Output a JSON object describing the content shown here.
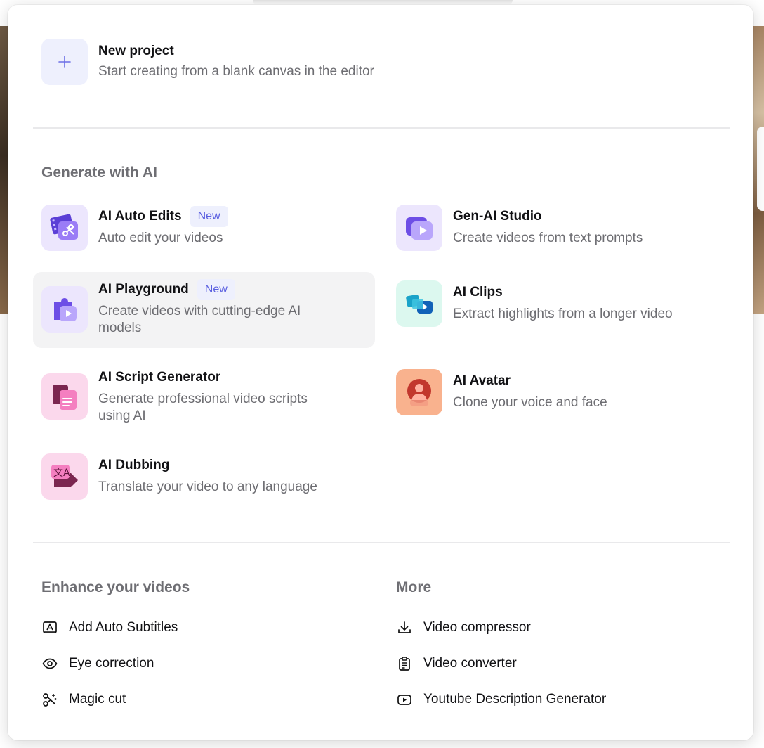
{
  "new_project": {
    "title": "New project",
    "subtitle": "Start creating from a blank canvas in the editor"
  },
  "generate": {
    "heading": "Generate with AI",
    "items": [
      {
        "title": "AI Auto Edits",
        "badge": "New",
        "subtitle": "Auto edit your videos",
        "icon": "film-scissors-icon"
      },
      {
        "title": "Gen-AI Studio",
        "subtitle": "Create videos from text prompts",
        "icon": "video-play-icon"
      },
      {
        "title": "AI Playground",
        "badge": "New",
        "subtitle": "Create videos with cutting-edge AI models",
        "icon": "puzzle-play-icon"
      },
      {
        "title": "AI Clips",
        "subtitle": "Extract highlights from a longer video",
        "icon": "clips-icon"
      },
      {
        "title": "AI Script Generator",
        "subtitle": "Generate professional video scripts using AI",
        "icon": "script-document-icon"
      },
      {
        "title": "AI Avatar",
        "subtitle": "Clone your voice and face",
        "icon": "avatar-person-icon"
      },
      {
        "title": "AI Dubbing",
        "subtitle": "Translate your video to any language",
        "icon": "translate-icon"
      }
    ]
  },
  "enhance": {
    "heading": "Enhance your videos",
    "items": [
      {
        "label": "Add Auto Subtitles",
        "icon": "subtitles-icon"
      },
      {
        "label": "Eye correction",
        "icon": "eye-icon"
      },
      {
        "label": "Magic cut",
        "icon": "magic-scissors-icon"
      }
    ]
  },
  "more": {
    "heading": "More",
    "items": [
      {
        "label": "Video compressor",
        "icon": "download-icon"
      },
      {
        "label": "Video converter",
        "icon": "clipboard-icon"
      },
      {
        "label": "Youtube Description Generator",
        "icon": "youtube-icon"
      }
    ]
  },
  "colors": {
    "accent": "#5a5fe0",
    "badge_bg": "#eef0fd",
    "subtext": "#6d6d72",
    "hover_bg": "#f3f3f4"
  }
}
